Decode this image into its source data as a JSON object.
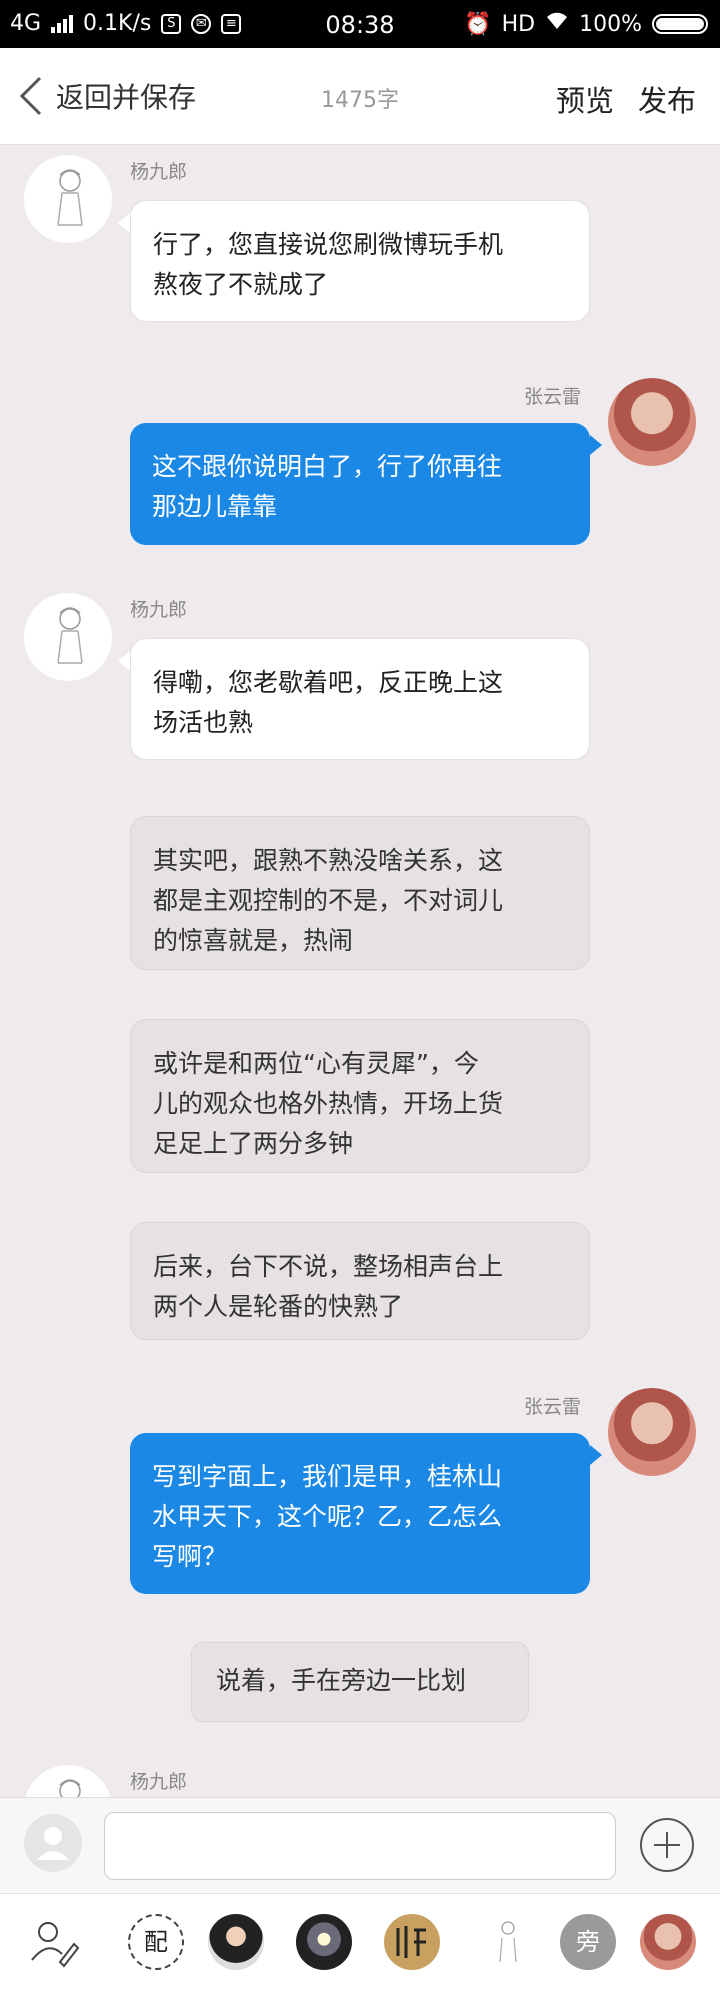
{
  "status_bar": {
    "network": "4G",
    "speed": "0.1K/s",
    "time": "08:38",
    "hd": "HD",
    "battery": "100%"
  },
  "nav": {
    "back_label": "返回并保存",
    "word_count": "1475字",
    "preview": "预览",
    "publish": "发布"
  },
  "characters": {
    "yang": "杨九郎",
    "zhang": "张云雷"
  },
  "messages": [
    {
      "speaker": "杨九郎",
      "side": "left",
      "text_lines": [
        "行了，您直接说您刷微博玩手机",
        "熬夜了不就成了"
      ]
    },
    {
      "speaker": "张云雷",
      "side": "right",
      "text_lines": [
        "这不跟你说明白了，行了你再往",
        "那边儿靠靠"
      ]
    },
    {
      "speaker": "杨九郎",
      "side": "left",
      "text_lines": [
        "得嘞，您老歇着吧，反正晚上这",
        "场活也熟"
      ]
    },
    {
      "side": "aside",
      "text_lines": [
        "其实吧，跟熟不熟没啥关系，这",
        "都是主观控制的不是，不对词儿",
        "的惊喜就是，热闹"
      ]
    },
    {
      "side": "aside",
      "text_lines": [
        "或许是和两位“心有灵犀”，今",
        "儿的观众也格外热情，开场上货",
        "足足上了两分多钟"
      ]
    },
    {
      "side": "aside",
      "text_lines": [
        "后来，台下不说，整场相声台上",
        "两个人是轮番的快熟了"
      ]
    },
    {
      "speaker": "张云雷",
      "side": "right",
      "text_lines": [
        "写到字面上，我们是甲，桂林山",
        "水甲天下，这个呢？乙，乙怎么",
        "写啊？"
      ]
    },
    {
      "side": "narration",
      "text": "说着，手在旁边一比划"
    },
    {
      "speaker": "杨九郎",
      "side": "left",
      "text_lines": []
    }
  ],
  "role_bar": {
    "pei_label": "配",
    "pang_label": "旁"
  },
  "colors": {
    "background": "#efeaee",
    "blue_bubble": "#1b88e6",
    "white_bubble": "#ffffff",
    "aside_bubble": "#e5e1e4"
  }
}
